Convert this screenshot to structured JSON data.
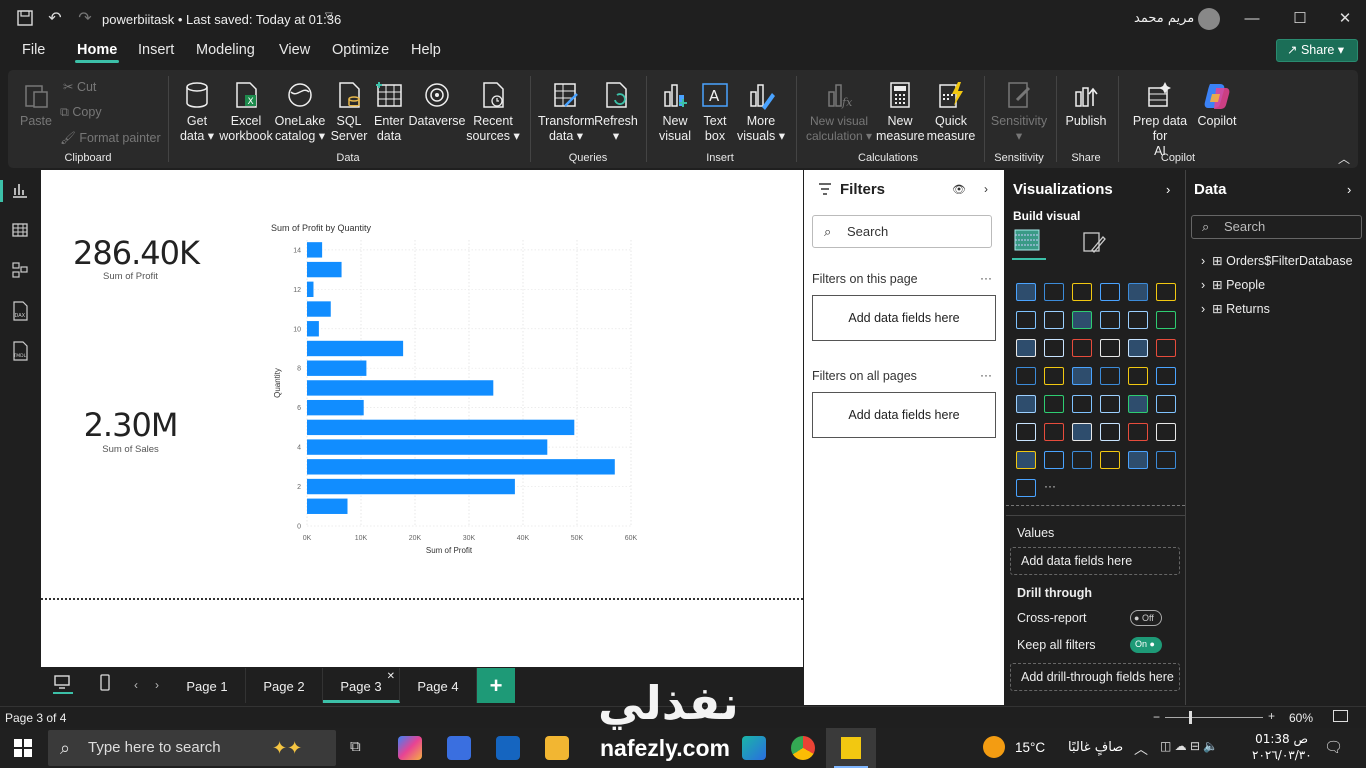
{
  "titlebar": {
    "title": "powerbiitask • Last saved: Today at 01:36",
    "user": "مريم محمد"
  },
  "menu": {
    "items": [
      "File",
      "Home",
      "Insert",
      "Modeling",
      "View",
      "Optimize",
      "Help"
    ],
    "active": "Home",
    "share": "Share"
  },
  "ribbon": {
    "clipboard": {
      "paste": "Paste",
      "cut": "Cut",
      "copy": "Copy",
      "format_painter": "Format painter",
      "label": "Clipboard"
    },
    "data": {
      "get_data": [
        "Get",
        "data ▾"
      ],
      "excel": [
        "Excel",
        "workbook"
      ],
      "onelake": [
        "OneLake",
        "catalog ▾"
      ],
      "sql": [
        "SQL",
        "Server"
      ],
      "enter": [
        "Enter",
        "data"
      ],
      "dataverse": [
        "Dataverse"
      ],
      "recent": [
        "Recent",
        "sources ▾"
      ],
      "label": "Data"
    },
    "queries": {
      "transform": [
        "Transform",
        "data ▾"
      ],
      "refresh": [
        "Refresh",
        "▾"
      ],
      "label": "Queries"
    },
    "insert": {
      "new_visual": [
        "New",
        "visual"
      ],
      "text_box": [
        "Text",
        "box"
      ],
      "more": [
        "More",
        "visuals ▾"
      ],
      "label": "Insert"
    },
    "calculations": {
      "new_visual_calc": [
        "New visual",
        "calculation ▾"
      ],
      "new_measure": [
        "New",
        "measure"
      ],
      "quick_measure": [
        "Quick",
        "measure"
      ],
      "label": "Calculations"
    },
    "sensitivity": {
      "btn": [
        "Sensitivity",
        "▾"
      ],
      "label": "Sensitivity"
    },
    "share": {
      "publish": [
        "Publish"
      ],
      "label": "Share"
    },
    "copilot": {
      "prep": [
        "Prep data for",
        "AI"
      ],
      "copilot": [
        "Copilot"
      ],
      "label": "Copilot"
    }
  },
  "kpis": [
    {
      "value": "286.40K",
      "label": "Sum of Profit"
    },
    {
      "value": "2.30M",
      "label": "Sum of Sales"
    }
  ],
  "chart_data": {
    "type": "bar",
    "orientation": "horizontal",
    "title": "Sum of Profit by Quantity",
    "xlabel": "Sum of Profit",
    "ylabel": "Quantity",
    "categories": [
      1,
      2,
      3,
      4,
      5,
      6,
      7,
      8,
      9,
      10,
      11,
      12,
      13,
      14
    ],
    "values": [
      7500,
      38500,
      57000,
      44500,
      49500,
      10500,
      34500,
      11000,
      17800,
      2200,
      4400,
      1200,
      6400,
      2800
    ],
    "xlim": [
      0,
      60000
    ],
    "xticks": [
      "0K",
      "10K",
      "20K",
      "30K",
      "40K",
      "50K",
      "60K"
    ],
    "yticks": [
      "0",
      "2",
      "4",
      "6",
      "8",
      "10",
      "12",
      "14"
    ],
    "ylim": [
      0,
      14
    ],
    "grid": true,
    "color": "#118dff"
  },
  "filters": {
    "title": "Filters",
    "search_placeholder": "Search",
    "on_page": "Filters on this page",
    "on_all": "Filters on all pages",
    "add_fields": "Add data fields here"
  },
  "visualizations": {
    "title": "Visualizations",
    "build_visual": "Build visual",
    "values": "Values",
    "add_fields": "Add data fields here",
    "drill_through": "Drill through",
    "cross_report": "Cross-report",
    "cross_state": "Off",
    "keep_filters": "Keep all filters",
    "keep_state": "On",
    "add_drill": "Add drill-through fields here",
    "more": "···"
  },
  "data_pane": {
    "title": "Data",
    "search_placeholder": "Search",
    "tables": [
      "Orders$FilterDatabase",
      "People",
      "Returns"
    ]
  },
  "pages": {
    "tabs": [
      "Page 1",
      "Page 2",
      "Page 3",
      "Page 4"
    ],
    "active": "Page 3",
    "add": "+"
  },
  "status": {
    "page": "Page 3 of 4",
    "zoom": "60%"
  },
  "taskbar": {
    "search": "Type here to search",
    "temp": "15°C",
    "weather": "صافٍ غالبًا",
    "time": "01:38 ص",
    "date": "٢٠٢٦/٠٣/٣٠"
  },
  "watermark": {
    "arabic": "نفذلي",
    "latin": "nafezly.com"
  },
  "colors": {
    "accent": "#3cc0a8",
    "bar": "#118dff",
    "share": "#1b6e57"
  }
}
